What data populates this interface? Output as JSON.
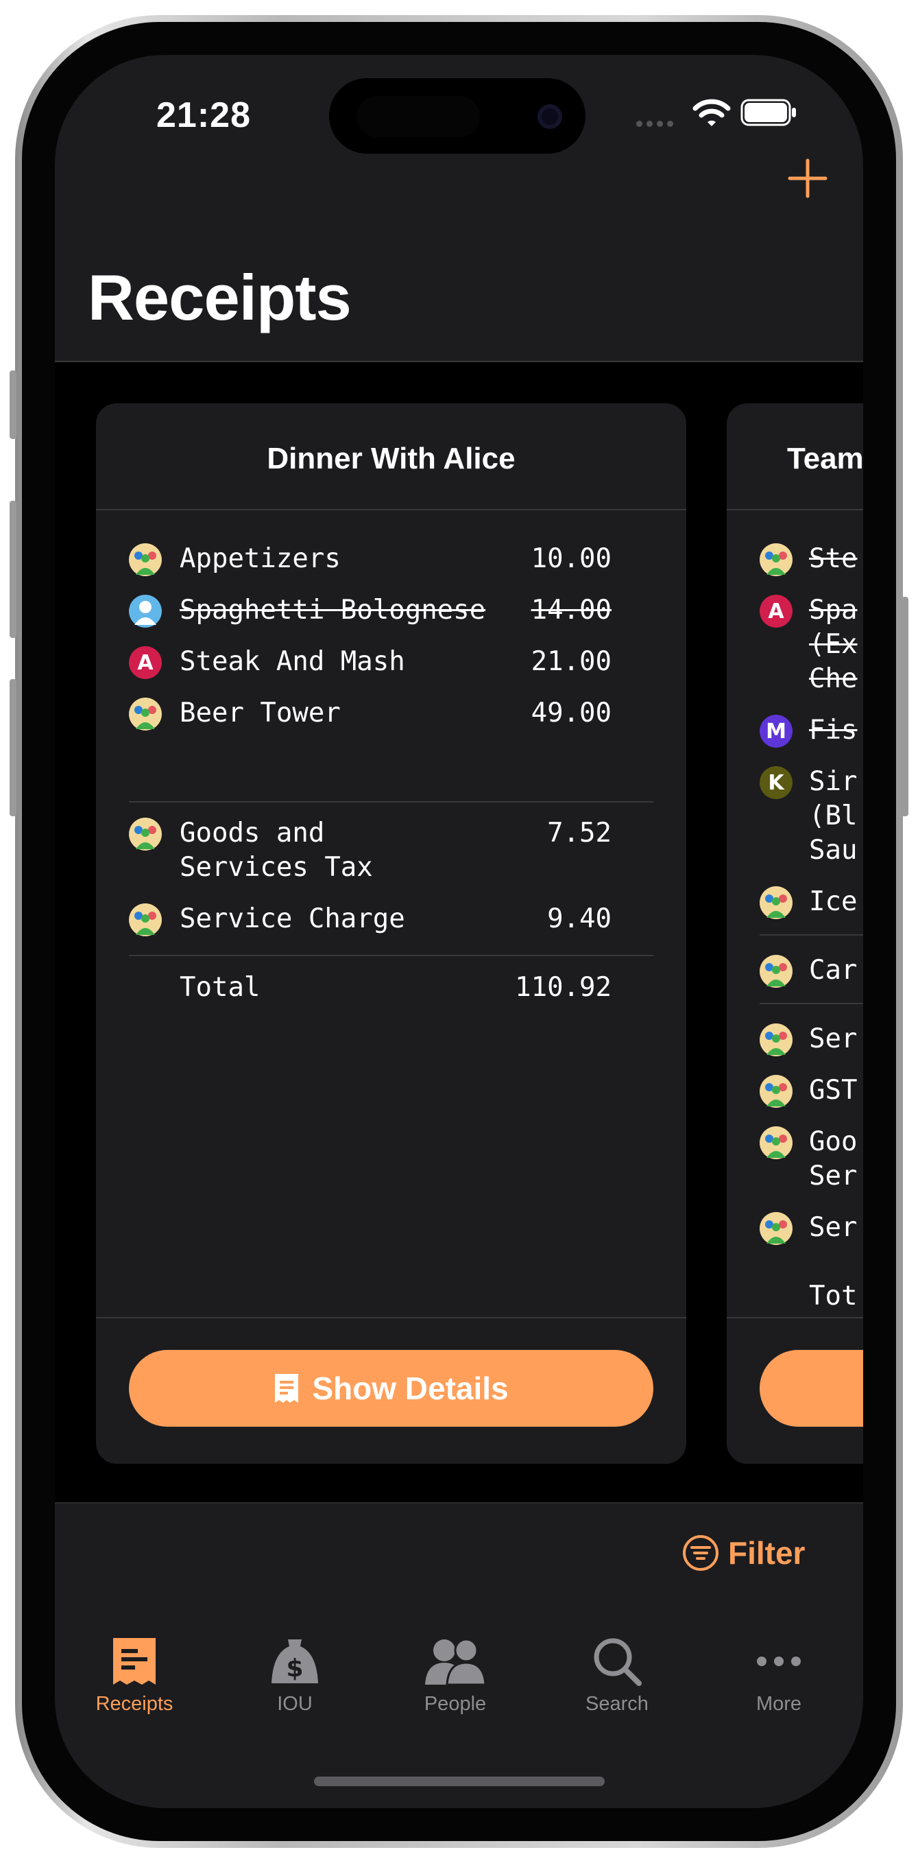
{
  "status_bar": {
    "time": "21:28"
  },
  "header": {
    "title": "Receipts",
    "add_icon": "plus-icon"
  },
  "receipts": [
    {
      "title": "Dinner With Alice",
      "items": [
        {
          "avatar": "group",
          "name": "Appetizers",
          "amount": "10.00",
          "struck": false
        },
        {
          "avatar": "person",
          "name": "Spaghetti Bolognese",
          "amount": "14.00",
          "struck": true
        },
        {
          "avatar": "A",
          "name": "Steak And Mash",
          "amount": "21.00",
          "struck": false
        },
        {
          "avatar": "group",
          "name": "Beer Tower",
          "amount": "49.00",
          "struck": false
        }
      ],
      "charges": [
        {
          "avatar": "group",
          "name_line1": "Goods and",
          "name_line2": "Services Tax",
          "amount": "7.52"
        },
        {
          "avatar": "group",
          "name": "Service Charge",
          "amount": "9.40"
        }
      ],
      "total_label": "Total",
      "total_amount": "110.92",
      "button_label": "Show Details"
    },
    {
      "title": "Team",
      "items": [
        {
          "avatar": "group",
          "name": "Ste",
          "struck": true
        },
        {
          "avatar": "A",
          "name_line1": "Spa",
          "name_line2": "(Ex",
          "name_line3": "Che",
          "struck": true
        },
        {
          "avatar": "M",
          "name": "Fis",
          "struck": true
        },
        {
          "avatar": "K",
          "name_line1": "Sir",
          "name_line2": "(Bl",
          "name_line3": "Sau",
          "struck": false
        },
        {
          "avatar": "group",
          "name": "Ice",
          "struck": false
        },
        {
          "avatar": "group",
          "name": "Car",
          "struck": false
        }
      ],
      "charges": [
        {
          "avatar": "group",
          "name": "Ser"
        },
        {
          "avatar": "group",
          "name": "GST"
        },
        {
          "avatar": "group",
          "name_line1": "Goo",
          "name_line2": "Ser"
        },
        {
          "avatar": "group",
          "name": "Ser"
        }
      ],
      "total_label": "Tot"
    }
  ],
  "filter_label": "Filter",
  "tabs": [
    {
      "label": "Receipts",
      "icon": "receipt-icon",
      "active": true
    },
    {
      "label": "IOU",
      "icon": "money-bag-icon",
      "active": false
    },
    {
      "label": "People",
      "icon": "people-icon",
      "active": false
    },
    {
      "label": "Search",
      "icon": "search-icon",
      "active": false
    },
    {
      "label": "More",
      "icon": "ellipsis-icon",
      "active": false
    }
  ],
  "colors": {
    "accent": "#ff9f5a",
    "background": "#000000",
    "surface": "#1c1c1e"
  }
}
